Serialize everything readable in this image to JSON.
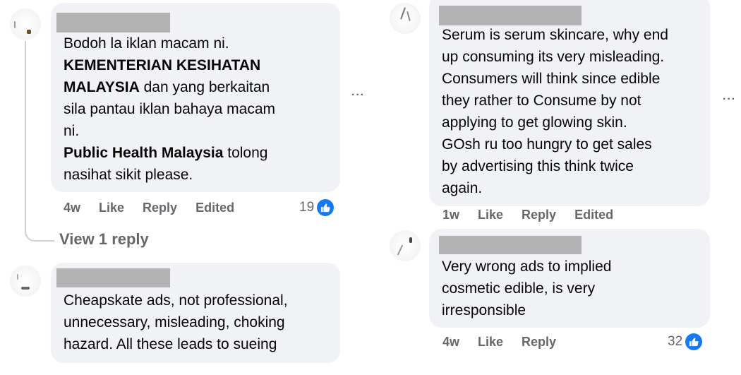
{
  "comments": [
    {
      "paragraphs": [
        {
          "lines": [
            [
              {
                "t": "Bodoh la iklan macam ni.",
                "b": false
              }
            ],
            [
              {
                "t": "KEMENTERIAN KESIHATAN",
                "b": true
              }
            ],
            [
              {
                "t": "MALAYSIA",
                "b": true
              },
              {
                "t": " dan yang berkaitan",
                "b": false
              }
            ],
            [
              {
                "t": "sila pantau iklan bahaya macam",
                "b": false
              }
            ],
            [
              {
                "t": "ni.",
                "b": false
              }
            ]
          ]
        },
        {
          "lines": [
            [
              {
                "t": "Public Health Malaysia",
                "b": true
              },
              {
                "t": " tolong",
                "b": false
              }
            ],
            [
              {
                "t": "nasihat sikit please.",
                "b": false
              }
            ]
          ]
        }
      ],
      "time": "4w",
      "like": "Like",
      "reply": "Reply",
      "edited": "Edited",
      "reactions": "19",
      "view_replies": "View 1 reply"
    },
    {
      "paragraphs": [
        {
          "lines": [
            [
              {
                "t": "Cheapskate ads, not professional,",
                "b": false
              }
            ],
            [
              {
                "t": "unnecessary, misleading, choking",
                "b": false
              }
            ],
            [
              {
                "t": "hazard. All these leads to sueing",
                "b": false
              }
            ]
          ]
        }
      ]
    },
    {
      "paragraphs": [
        {
          "lines": [
            [
              {
                "t": "Serum is serum skincare, why end",
                "b": false
              }
            ],
            [
              {
                "t": "up consuming its very misleading.",
                "b": false
              }
            ],
            [
              {
                "t": "Consumers will think since edible",
                "b": false
              }
            ],
            [
              {
                "t": "they rather to Consume by not",
                "b": false
              }
            ],
            [
              {
                "t": "applying to get glowing skin.",
                "b": false
              }
            ],
            [
              {
                "t": "GOsh ru too hungry to get sales",
                "b": false
              }
            ],
            [
              {
                "t": "by advertising this think twice",
                "b": false
              }
            ],
            [
              {
                "t": "again.",
                "b": false
              }
            ]
          ]
        }
      ],
      "time": "1w",
      "like": "Like",
      "reply": "Reply",
      "edited": "Edited"
    },
    {
      "paragraphs": [
        {
          "lines": [
            [
              {
                "t": "Very wrong ads to implied",
                "b": false
              }
            ],
            [
              {
                "t": "cosmetic edible, is very",
                "b": false
              }
            ],
            [
              {
                "t": "irresponsible",
                "b": false
              }
            ]
          ]
        }
      ],
      "time": "4w",
      "like": "Like",
      "reply": "Reply",
      "reactions": "32"
    }
  ],
  "more_options": "···",
  "colors": {
    "bubble": "#f0f2f5",
    "meta": "#65676b",
    "like_blue": "#1877f2",
    "redaction": "#b3b3b3"
  },
  "icons": {
    "reaction": "thumbs-up-icon",
    "more": "more-options-icon"
  }
}
